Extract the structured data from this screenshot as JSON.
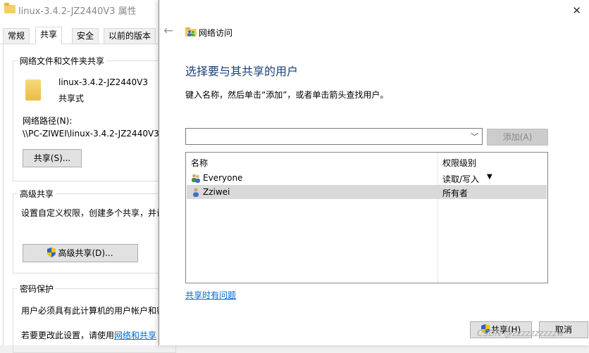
{
  "props": {
    "title": "linux-3.4.2-JZ2440V3 属性",
    "tabs": [
      "常规",
      "共享",
      "安全",
      "以前的版本"
    ],
    "net_share_group": "网络文件和文件夹共享",
    "folder_name": "linux-3.4.2-JZ2440V3",
    "share_state": "共享式",
    "net_path_label": "网络路径(N):",
    "net_path": "\\\\PC-ZIWEI\\linux-3.4.2-JZ2440V3",
    "share_button": "共享(S)...",
    "advanced_group": "高级共享",
    "advanced_desc": "设置自定义权限，创建多个共享，并设",
    "advanced_button": "高级共享(D)...",
    "password_group": "密码保护",
    "password_desc": "用户必须具有此计算机的用户帐户和密",
    "change_text": "若要更改此设置，请使用",
    "change_link": "网络和共享"
  },
  "dialog": {
    "window_title": "网络访问",
    "heading": "选择要与其共享的用户",
    "instruction": "键入名称，然后单击“添加”，或者单击箭头查找用户。",
    "input_value": "",
    "add_button": "添加(A)",
    "columns": {
      "name": "名称",
      "permission": "权限级别"
    },
    "users": [
      {
        "name": "Everyone",
        "permission": "读取/写入",
        "has_menu": true
      },
      {
        "name": "Zziwei",
        "permission": "所有者",
        "selected": true
      }
    ],
    "trouble_link": "共享时有问题",
    "share_button": "共享(H)",
    "cancel_button": "取消"
  },
  "watermark": "CSDN @zzzzzzzzzzw"
}
